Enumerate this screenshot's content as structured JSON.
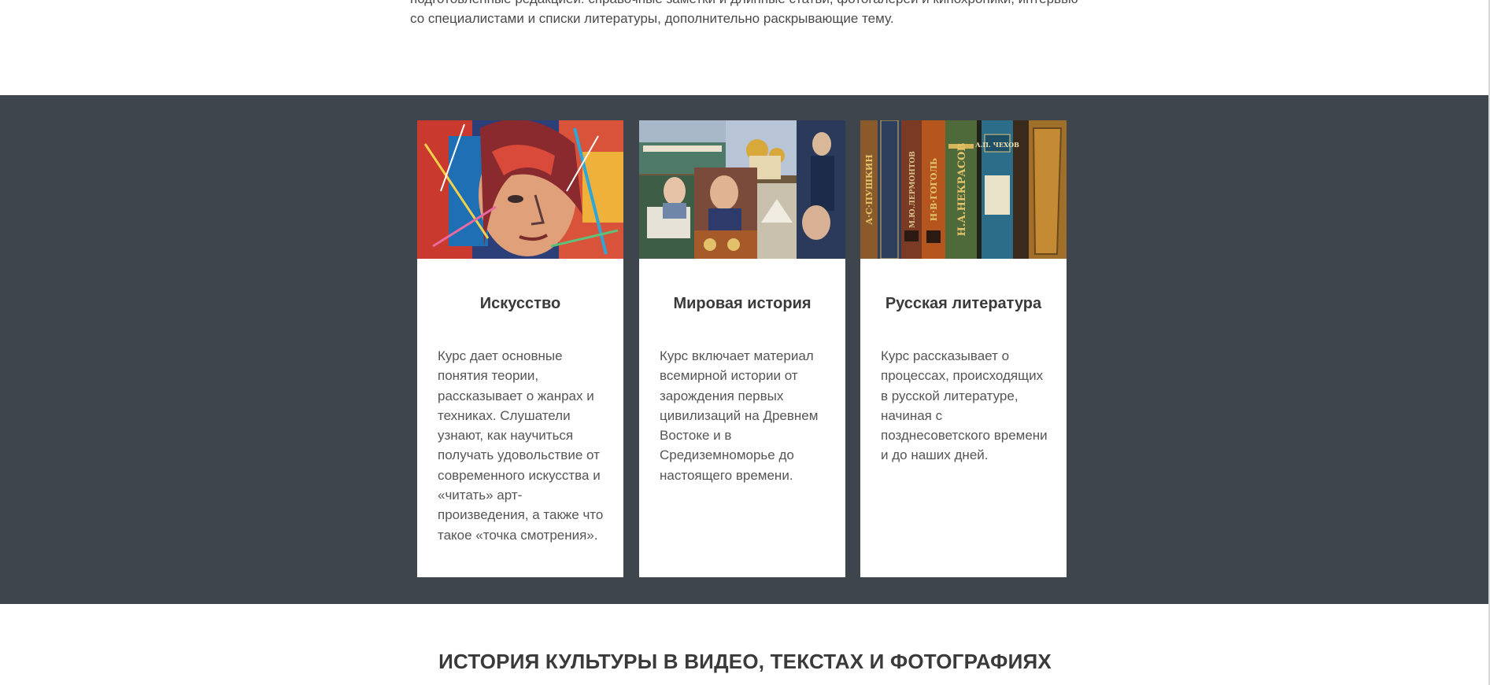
{
  "intro": {
    "text_line_1": "подготовленные редакцией: справочные заметки и длинные статьи, фотогалереи и кинохроники, интервью",
    "text_line_2": "со специалистами и списки литературы, дополнительно раскрывающие тему."
  },
  "courses": [
    {
      "title": "Искусство",
      "description": "Курс дает основные понятия теории, рассказывает о жанрах и техниках. Слушатели узнают, как научиться получать удовольствие от современного искусства и «читать» арт-произведения, а также что такое «точка смотрения».",
      "image": "art-portrait-image"
    },
    {
      "title": "Мировая история",
      "description": "Курс включает материал всемирной истории от зарождения первых цивилизаций на Древнем Востоке и в Средиземноморье до настоящего времени.",
      "image": "world-history-collage-image"
    },
    {
      "title": "Русская литература",
      "description": "Курс рассказывает о процессах, происходящих в русской литературе, начиная с позднесоветского времени и до наших дней.",
      "image": "russian-books-image",
      "book_spines": [
        "А·С·ПУШКИН",
        "М.Ю.ЛЕРМОНТОВ",
        "Н·В·ГОГОЛЬ",
        "Н.А.НЕКРАСОВ",
        "А.П. ЧЕХОВ"
      ]
    }
  ],
  "section": {
    "heading": "ИСТОРИЯ КУЛЬТУРЫ В ВИДЕО, ТЕКСТАХ И ФОТОГРАФИЯХ"
  },
  "colors": {
    "band_background": "#3e454d",
    "card_background": "#ffffff",
    "text": "#3a3a3a"
  }
}
